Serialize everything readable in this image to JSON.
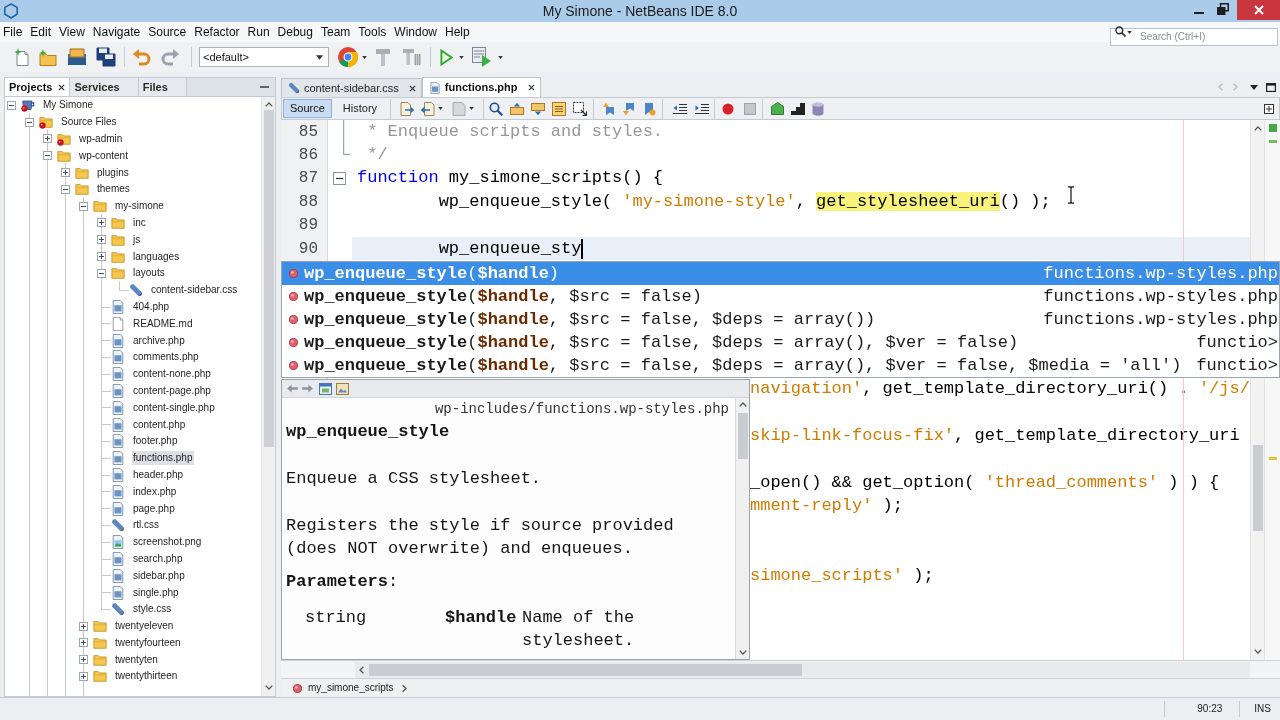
{
  "window": {
    "title": "My Simone - NetBeans IDE 8.0"
  },
  "menu": [
    "File",
    "Edit",
    "View",
    "Navigate",
    "Source",
    "Refactor",
    "Run",
    "Debug",
    "Team",
    "Tools",
    "Window",
    "Help"
  ],
  "search": {
    "placeholder": "Search (Ctrl+I)"
  },
  "toolbar": {
    "configuration": "<default>"
  },
  "projects_panel": {
    "tabs": [
      {
        "label": "Projects",
        "selected": true,
        "closable": true
      },
      {
        "label": "Services",
        "selected": false,
        "closable": false
      },
      {
        "label": "Files",
        "selected": false,
        "closable": false
      }
    ],
    "tree": [
      {
        "label": "My Simone",
        "kind": "project",
        "expanded": true,
        "error": true,
        "selected": false,
        "children": [
          {
            "label": "Source Files",
            "kind": "folder",
            "expanded": true,
            "error": true,
            "selected": false,
            "children": [
              {
                "label": "wp-admin",
                "kind": "folder",
                "expanded": false,
                "error": true,
                "selected": false
              },
              {
                "label": "wp-content",
                "kind": "folder",
                "expanded": true,
                "error": false,
                "selected": false,
                "children": [
                  {
                    "label": "plugins",
                    "kind": "folder",
                    "expanded": false,
                    "error": false,
                    "selected": false
                  },
                  {
                    "label": "themes",
                    "kind": "folder",
                    "expanded": true,
                    "error": false,
                    "selected": false,
                    "children": [
                      {
                        "label": "my-simone",
                        "kind": "folder",
                        "expanded": true,
                        "error": false,
                        "selected": false,
                        "children": [
                          {
                            "label": "inc",
                            "kind": "folder",
                            "expanded": false,
                            "error": false,
                            "selected": false
                          },
                          {
                            "label": "js",
                            "kind": "folder",
                            "expanded": false,
                            "error": false,
                            "selected": false
                          },
                          {
                            "label": "languages",
                            "kind": "folder",
                            "expanded": false,
                            "error": false,
                            "selected": false
                          },
                          {
                            "label": "layouts",
                            "kind": "folder",
                            "expanded": true,
                            "error": false,
                            "selected": false,
                            "children": [
                              {
                                "label": "content-sidebar.css",
                                "kind": "css",
                                "error": false,
                                "selected": false
                              }
                            ]
                          },
                          {
                            "label": "404.php",
                            "kind": "php",
                            "error": false,
                            "selected": false
                          },
                          {
                            "label": "README.md",
                            "kind": "text",
                            "error": false,
                            "selected": false
                          },
                          {
                            "label": "archive.php",
                            "kind": "php",
                            "error": false,
                            "selected": false
                          },
                          {
                            "label": "comments.php",
                            "kind": "php",
                            "error": false,
                            "selected": false
                          },
                          {
                            "label": "content-none.php",
                            "kind": "php",
                            "error": false,
                            "selected": false
                          },
                          {
                            "label": "content-page.php",
                            "kind": "php",
                            "error": false,
                            "selected": false
                          },
                          {
                            "label": "content-single.php",
                            "kind": "php",
                            "error": false,
                            "selected": false
                          },
                          {
                            "label": "content.php",
                            "kind": "php",
                            "error": false,
                            "selected": false
                          },
                          {
                            "label": "footer.php",
                            "kind": "php",
                            "error": false,
                            "selected": false
                          },
                          {
                            "label": "functions.php",
                            "kind": "php",
                            "error": false,
                            "selected": true
                          },
                          {
                            "label": "header.php",
                            "kind": "php",
                            "error": false,
                            "selected": false
                          },
                          {
                            "label": "index.php",
                            "kind": "php",
                            "error": false,
                            "selected": false
                          },
                          {
                            "label": "page.php",
                            "kind": "php",
                            "error": false,
                            "selected": false
                          },
                          {
                            "label": "rtl.css",
                            "kind": "css",
                            "error": false,
                            "selected": false
                          },
                          {
                            "label": "screenshot.png",
                            "kind": "image",
                            "error": false,
                            "selected": false
                          },
                          {
                            "label": "search.php",
                            "kind": "php",
                            "error": false,
                            "selected": false
                          },
                          {
                            "label": "sidebar.php",
                            "kind": "php",
                            "error": false,
                            "selected": false
                          },
                          {
                            "label": "single.php",
                            "kind": "php",
                            "error": false,
                            "selected": false
                          },
                          {
                            "label": "style.css",
                            "kind": "css",
                            "error": false,
                            "selected": false
                          }
                        ]
                      },
                      {
                        "label": "twentyeleven",
                        "kind": "folder",
                        "expanded": false,
                        "error": false,
                        "selected": false
                      },
                      {
                        "label": "twentyfourteen",
                        "kind": "folder",
                        "expanded": false,
                        "error": false,
                        "selected": false
                      },
                      {
                        "label": "twentyten",
                        "kind": "folder",
                        "expanded": false,
                        "error": false,
                        "selected": false
                      },
                      {
                        "label": "twentythirteen",
                        "kind": "folder",
                        "expanded": false,
                        "error": false,
                        "selected": false
                      }
                    ]
                  }
                ]
              }
            ]
          }
        ]
      }
    ]
  },
  "editor": {
    "tabs": [
      {
        "label": "content-sidebar.css",
        "kind": "css",
        "selected": false,
        "closable": true
      },
      {
        "label": "functions.php",
        "kind": "php",
        "selected": true,
        "closable": true
      }
    ],
    "views": [
      {
        "label": "Source",
        "selected": true
      },
      {
        "label": "History",
        "selected": false
      }
    ],
    "lines": [
      {
        "number": "85",
        "kind": "fold-body",
        "current": false,
        "tokens": [
          {
            "text": " * Enqueue scripts and styles.",
            "kind": "comment"
          }
        ]
      },
      {
        "number": "86",
        "kind": "fold-end",
        "current": false,
        "tokens": [
          {
            "text": " */",
            "kind": "comment"
          }
        ]
      },
      {
        "number": "87",
        "kind": "fold-start",
        "current": false,
        "tokens": [
          {
            "text": "function",
            "kind": "keyword"
          },
          {
            "text": " my_simone_scripts() {",
            "kind": "plain"
          }
        ]
      },
      {
        "number": "88",
        "kind": "code",
        "current": false,
        "tokens": [
          {
            "text": "        wp_enqueue_style( ",
            "kind": "plain"
          },
          {
            "text": "'my-simone-style'",
            "kind": "string"
          },
          {
            "text": ", ",
            "kind": "plain"
          },
          {
            "text": "get_stylesheet_uri",
            "kind": "mark"
          },
          {
            "text": "() );",
            "kind": "plain"
          }
        ]
      },
      {
        "number": "89",
        "kind": "code",
        "current": false
      },
      {
        "number": "90",
        "kind": "code",
        "current": true,
        "tokens": [
          {
            "text": "        wp_enqueue_sty",
            "kind": "plain"
          }
        ]
      }
    ],
    "completion": [
      {
        "name": "wp_enqueue_style",
        "params": "(**$handle**)",
        "file": "functions.wp-styles.php",
        "selected": true
      },
      {
        "name": "wp_enqueue_style",
        "params": "(**$handle**, $src = false)",
        "file": "functions.wp-styles.php",
        "selected": false
      },
      {
        "name": "wp_enqueue_style",
        "params": "(**$handle**, $src = false, $deps = array())",
        "file": "functions.wp-styles.php",
        "selected": false
      },
      {
        "name": "wp_enqueue_style",
        "params": "(**$handle**, $src = false, $deps = array(), $ver = false)",
        "file": "functio>",
        "selected": false
      },
      {
        "name": "wp_enqueue_style",
        "params": "(**$handle**, $src = false, $deps = array(), $ver = false, $media = 'all')",
        "file": "functio>",
        "selected": false
      }
    ],
    "documentation": {
      "file": "wp-includes/functions.wp-styles.php",
      "title": "wp_enqueue_style",
      "paragraphs": [
        "Enqueue a CSS stylesheet.",
        "Registers the style if source provided (does NOT overwrite) and enqueues."
      ],
      "heading": "**Parameters**:",
      "parameters": [
        {
          "type": "string",
          "name": "$handle",
          "description": "Name of the stylesheet."
        }
      ]
    },
    "code_right_of_popup": [
      {
        "kind": "code",
        "tokens": [
          {
            "text": "navigation'",
            "kind": "string"
          },
          {
            "text": ", get_template_directory_uri() . ",
            "kind": "plain"
          },
          {
            "text": "'/js/",
            "kind": "string"
          }
        ]
      },
      {
        "kind": "blank"
      },
      {
        "kind": "code",
        "tokens": [
          {
            "text": "skip-link-focus-fix'",
            "kind": "string"
          },
          {
            "text": ", get_template_directory_uri",
            "kind": "plain"
          }
        ]
      },
      {
        "kind": "blank"
      },
      {
        "kind": "code",
        "tokens": [
          {
            "text": "_open() && get_option( ",
            "kind": "plain"
          },
          {
            "text": "'thread_comments'",
            "kind": "string"
          },
          {
            "text": " ) ) {",
            "kind": "plain"
          }
        ]
      },
      {
        "kind": "code",
        "tokens": [
          {
            "text": "mment-reply'",
            "kind": "string"
          },
          {
            "text": " );",
            "kind": "plain"
          }
        ]
      },
      {
        "kind": "blank"
      },
      {
        "kind": "blank"
      },
      {
        "kind": "code",
        "tokens": [
          {
            "text": "simone_scripts'",
            "kind": "string"
          },
          {
            "text": " );",
            "kind": "plain"
          }
        ]
      }
    ],
    "breadcrumb": [
      {
        "label": "my_simone_scripts"
      }
    ]
  },
  "status_bar": {
    "position": "90:23",
    "mode": "INS"
  }
}
